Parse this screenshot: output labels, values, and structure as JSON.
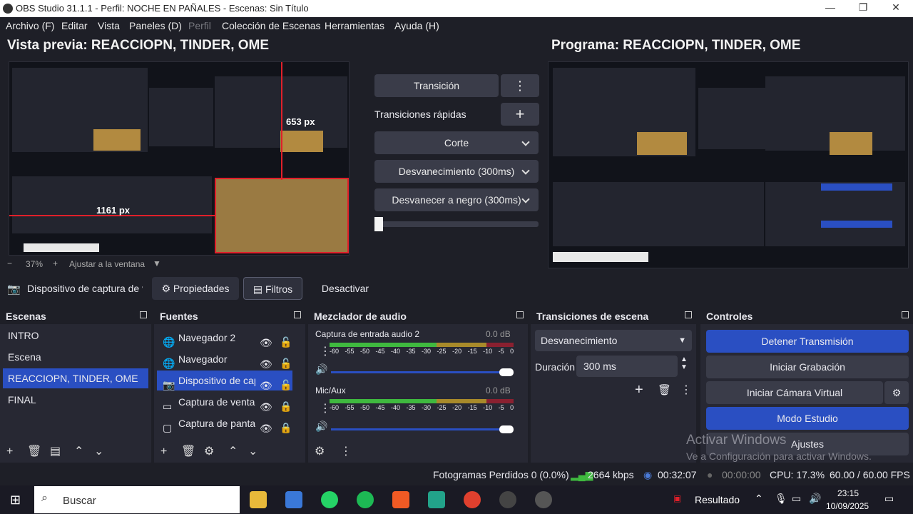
{
  "window": {
    "title": "OBS Studio 31.1.1 - Perfil: NOCHE EN PAÑALES - Escenas: Sin Título"
  },
  "menu": [
    {
      "label": "Archivo (F)",
      "enabled": true
    },
    {
      "label": "Editar",
      "enabled": true
    },
    {
      "label": "Vista",
      "enabled": true
    },
    {
      "label": "Paneles (D)",
      "enabled": true
    },
    {
      "label": "Perfil",
      "enabled": false
    },
    {
      "label": "Colección de Escenas",
      "enabled": true
    },
    {
      "label": "Herramientas",
      "enabled": true
    },
    {
      "label": "Ayuda (H)",
      "enabled": true
    }
  ],
  "preview": {
    "title": "Vista previa: REACCIOPN, TINDER, OME",
    "measure_top": "653 px",
    "measure_left": "1161 px",
    "zoom": "37%",
    "fit_label": "Ajustar a la ventana"
  },
  "program": {
    "title": "Programa: REACCIOPN, TINDER, OME"
  },
  "transitions_center": {
    "transition_button": "Transición",
    "quick_label": "Transiciones rápidas",
    "cut": "Corte",
    "fade": "Desvanecimiento (300ms)",
    "fade_black": "Desvanecer a negro (300ms)"
  },
  "source_toolbar": {
    "source_name": "Dispositivo de captura de v",
    "properties": "Propiedades",
    "filters": "Filtros",
    "deactivate": "Desactivar"
  },
  "scenes": {
    "title": "Escenas",
    "items": [
      "INTRO",
      "Escena",
      "REACCIOPN, TINDER, OME",
      "FINAL"
    ],
    "selected_index": 2
  },
  "sources": {
    "title": "Fuentes",
    "items": [
      {
        "name": "Navegador 2",
        "icon": "globe-icon"
      },
      {
        "name": "Navegador",
        "icon": "globe-icon"
      },
      {
        "name": "Dispositivo de cap",
        "icon": "camera-icon"
      },
      {
        "name": "Captura de ventar",
        "icon": "window-icon"
      },
      {
        "name": "Captura de panta",
        "icon": "monitor-icon"
      }
    ],
    "selected_index": 2
  },
  "mixer": {
    "title": "Mezclador de audio",
    "scale": "-60 -55 -50 -45 -40 -35 -30 -25 -20 -15 -10 -5 0",
    "channels": [
      {
        "name": "Captura de entrada audio 2",
        "db": "0.0 dB",
        "volume": 1.0
      },
      {
        "name": "Mic/Aux",
        "db": "0.0 dB",
        "volume": 1.0
      }
    ]
  },
  "scene_transitions": {
    "title": "Transiciones de escena",
    "selected": "Desvanecimiento",
    "duration_label": "Duración",
    "duration_value": "300 ms"
  },
  "controls": {
    "title": "Controles",
    "stop_stream": "Detener Transmisión",
    "start_recording": "Iniciar Grabación",
    "virtual_camera": "Iniciar Cámara Virtual",
    "studio_mode": "Modo Estudio",
    "settings": "Ajustes"
  },
  "watermark": {
    "line1": "Activar Windows",
    "line2": "Ve a Configuración para activar Windows."
  },
  "status": {
    "dropped": "Fotogramas Perdidos 0 (0.0%)",
    "bitrate": "2664 kbps",
    "stream_time": "00:32:07",
    "rec_time": "00:00:00",
    "cpu": "CPU: 17.3%",
    "fps": "60.00 / 60.00 FPS"
  },
  "taskbar": {
    "search_placeholder": "Buscar",
    "news": "Resultado",
    "time": "23:15",
    "date": "10/09/2025"
  },
  "colors": {
    "accent": "#2a4fc2",
    "bg": "#1e1f27",
    "panel": "#272833",
    "red": "#e0202a"
  }
}
